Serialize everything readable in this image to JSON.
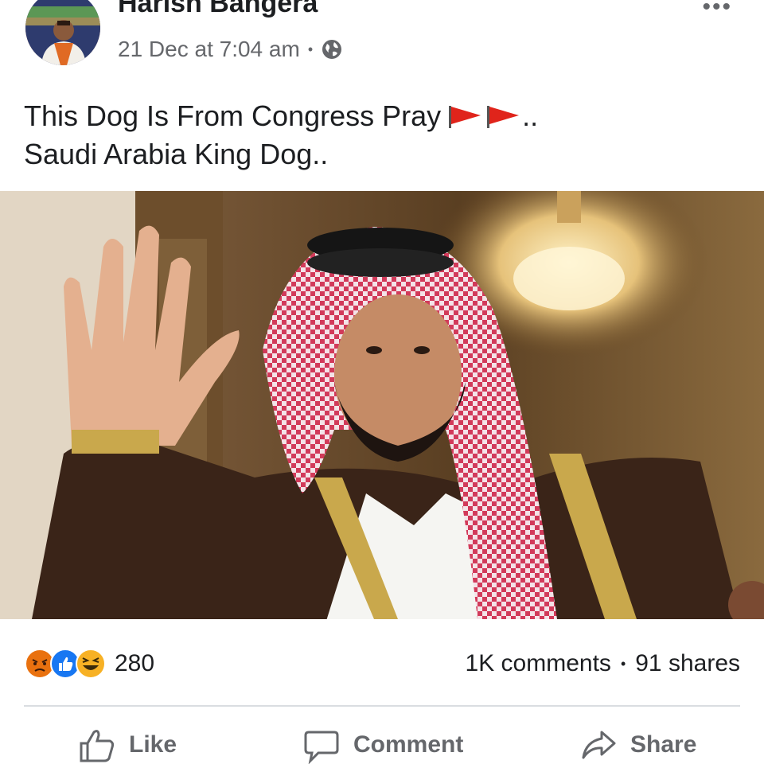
{
  "post": {
    "author": "Harish Bangera",
    "timestamp": "21 Dec at 7:04 am",
    "privacy_icon": "globe-icon",
    "more_icon": "more-options-icon",
    "more_label": "•••",
    "caption_line1": "This Dog Is From Congress Pray",
    "caption_line1_suffix": "..",
    "caption_line2": "Saudi Arabia King Dog..",
    "flag_icon": "red-flag-icon"
  },
  "reactions": {
    "icons": [
      "angry-reaction-icon",
      "like-reaction-icon",
      "haha-reaction-icon"
    ],
    "count": "280"
  },
  "stats": {
    "comments": "1K comments",
    "separator": "•",
    "shares": "91 shares"
  },
  "actions": {
    "like_label": "Like",
    "comment_label": "Comment",
    "share_label": "Share"
  },
  "colors": {
    "text": "#1c1e21",
    "secondary": "#65676b",
    "like_blue": "#1877f2",
    "angry_orange": "#e9710f",
    "haha_yellow": "#f7b125",
    "flag_red": "#e0241b"
  }
}
